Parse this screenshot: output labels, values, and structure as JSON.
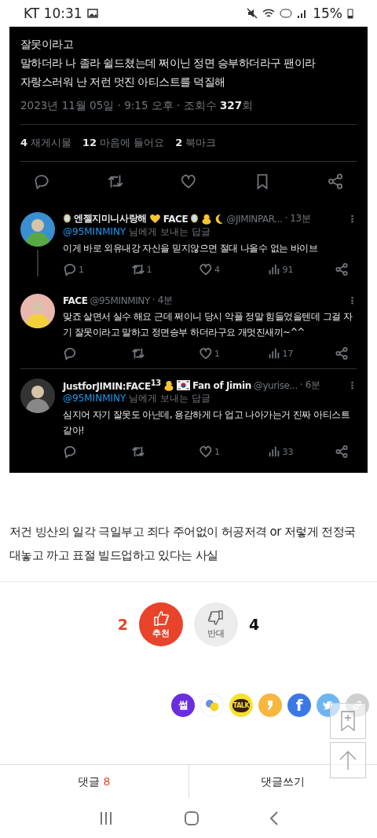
{
  "status_bar": {
    "carrier_time": "KT 10:31",
    "battery": "15%"
  },
  "tweet": {
    "text_lines": [
      "잘못이라고",
      "말하더라 나 졸라 쉴드쳤는데  쩌이닌 정면 승부하더라구 팬이라",
      "자랑스러워 난 저런 멋진 아티스트를 덕질해"
    ],
    "meta": "2023년 11월 05일 · 9:15 오후 · 조회수 **327**회",
    "stats": [
      {
        "count": "4",
        "label": "재게시물"
      },
      {
        "count": "12",
        "label": "마음에 들어요"
      },
      {
        "count": "2",
        "label": "북마크"
      }
    ],
    "replies": [
      {
        "name": [
          {
            "kind": "mirror"
          },
          {
            "kind": "text",
            "text": "엔젤지미니사랑해"
          },
          {
            "kind": "heart"
          },
          {
            "kind": "text",
            "text": "FACE"
          },
          {
            "kind": "mirror"
          },
          {
            "kind": "chick"
          },
          {
            "kind": "moon"
          }
        ],
        "handle": "@JIMINPAR...",
        "time": "· 13분",
        "reply_to": "@95MINMINY",
        "reply_label": "님에게 보내는 답글",
        "text": "이게 바로 외유내강 자신을 믿지않으면 절대 나올수 없는 바이브",
        "thread_line": true,
        "more": "⋮",
        "actions": {
          "reply": "1",
          "repost": "1",
          "like": "4",
          "views": "91"
        }
      },
      {
        "name": [
          {
            "kind": "text",
            "text": "FACE"
          }
        ],
        "handle": "@95MINMINY",
        "time": "· 4분",
        "text": "맞죠 살면서 실수 해요 근데 쩌이니 당시 악플 정말 힘들었을텐데 그걸 자기 잘못이라고 말하고 정면승부 하더라구요 개멋진새끼~^^",
        "thread_line": false,
        "more": "⋮",
        "actions": {
          "like": "1",
          "views": "17"
        }
      },
      {
        "name": [
          {
            "kind": "text",
            "text": "JustforJIMIN:FACE$^{13}$"
          },
          {
            "kind": "chick"
          },
          {
            "kind": "flag"
          },
          {
            "kind": "text",
            "text": "Fan of Jimin"
          }
        ],
        "handle": "@yurise...",
        "time": "· 6분",
        "reply_to": "@95MINMINY",
        "reply_label": "님에게 보내는 답글",
        "text": "심지어 자기 잘못도 아닌데, 용감하게 다 업고 나아가는거 진짜 아티스트 같아!",
        "thread_line": false,
        "more": "⋮",
        "actions": {
          "like": "1",
          "views": "33"
        }
      }
    ]
  },
  "article_text": "저건 빙산의 일각 극일부고 죄다 주어없이 허공저격 or 저렇게 전정국 대놓고 까고 표절 빌드업하고 있다는 사실",
  "votes": [
    {
      "kind": "up",
      "count": "2",
      "label": "추천"
    },
    {
      "kind": "down",
      "count": "4",
      "label": "반대"
    }
  ],
  "share": [
    {
      "kind": "ssul",
      "label": "썰"
    },
    {
      "kind": "daum"
    },
    {
      "kind": "kakaotalk",
      "label": "TALK"
    },
    {
      "kind": "story"
    },
    {
      "kind": "facebook",
      "label": "f"
    },
    {
      "kind": "twitter"
    },
    {
      "kind": "link"
    }
  ],
  "bottom_tabs": [
    {
      "label": "댓글",
      "count": "8"
    },
    {
      "label": "댓글쓰기"
    }
  ]
}
